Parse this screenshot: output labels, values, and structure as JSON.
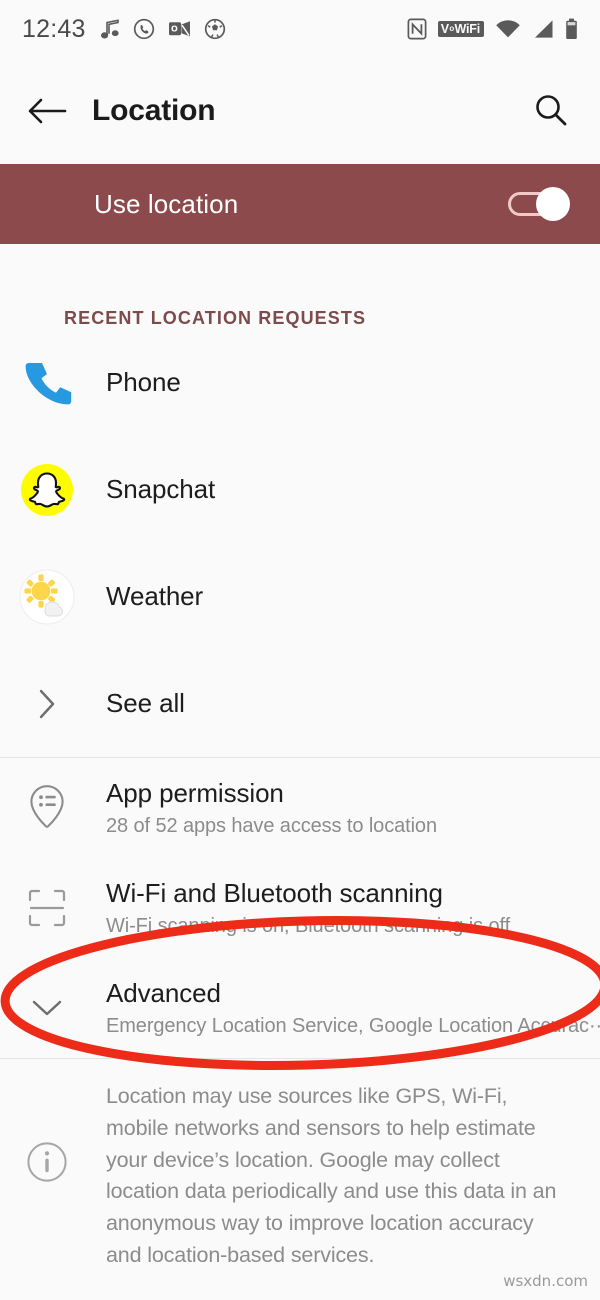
{
  "statusbar": {
    "clock": "12:43",
    "left_icons": [
      "music-note-icon",
      "whatsapp-icon",
      "outlook-icon",
      "soccer-ball-icon"
    ],
    "right_icons": [
      "nfc-icon",
      "vowifi-icon",
      "wifi-icon",
      "cellular-signal-icon",
      "battery-icon"
    ],
    "vowifi_label": "WiFi",
    "vowifi_prefix": "V",
    "vowifi_sup": "o"
  },
  "appbar": {
    "back_icon": "arrow-left-icon",
    "title": "Location",
    "search_icon": "search-icon"
  },
  "banner": {
    "label": "Use location",
    "toggle_state": "on",
    "background": "#8d4a4d"
  },
  "section": {
    "title": "RECENT LOCATION REQUESTS",
    "color": "#7d4b4b"
  },
  "recent_apps": [
    {
      "label": "Phone",
      "icon": "phone-icon"
    },
    {
      "label": "Snapchat",
      "icon": "snapchat-icon"
    },
    {
      "label": "Weather",
      "icon": "weather-icon"
    }
  ],
  "see_all": {
    "label": "See all",
    "icon": "chevron-right-icon"
  },
  "settings": [
    {
      "title": "App permission",
      "subtitle": "28 of 52 apps have access to location",
      "icon": "location-pin-list-icon"
    },
    {
      "title": "Wi-Fi and Bluetooth scanning",
      "subtitle": "Wi-Fi scanning is on, Bluetooth scanning is off",
      "icon": "scan-frame-icon"
    },
    {
      "title": "Advanced",
      "subtitle": "Emergency Location Service, Google Location Accurac··",
      "icon": "chevron-down-icon"
    }
  ],
  "footer": {
    "icon": "info-icon",
    "text": "Location may use sources like GPS, Wi-Fi, mobile networks and sensors to help estimate your device’s location. Google may collect location data periodically and use this data in an anonymous way to improve location accuracy and location-based services."
  },
  "annotation": {
    "shape": "ellipse-highlight",
    "color": "#ec2b18",
    "target": "Advanced"
  },
  "watermark": {
    "text": "wsxdn.com"
  }
}
